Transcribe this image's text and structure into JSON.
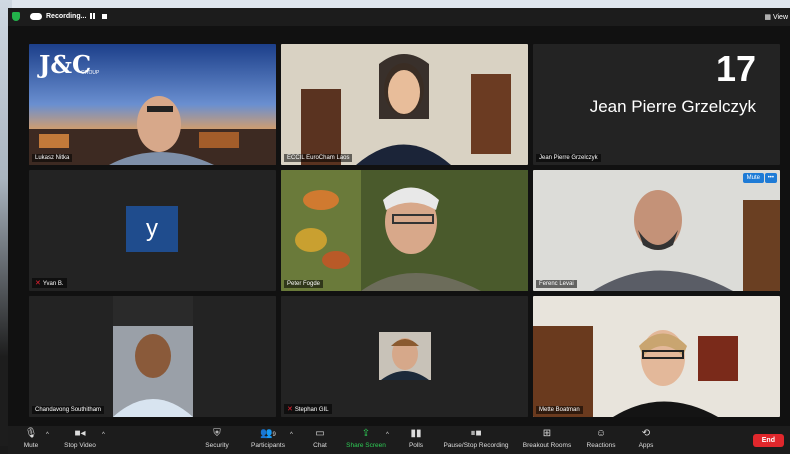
{
  "recording": {
    "label": "Recording..."
  },
  "view_label": "View",
  "tiles": [
    {
      "name": "Lukasz Nitka",
      "logo": "J&C",
      "logo_sub": "GROUP"
    },
    {
      "name": "ECCIL EuroCham Laos"
    },
    {
      "name": "Jean Pierre Grzelczyk",
      "big_name": "Jean Pierre Grzelczyk",
      "count": "17"
    },
    {
      "name": "Yvan B.",
      "avatar_letter": "y"
    },
    {
      "name": "Peter Fogde"
    },
    {
      "name": "Ferenc Levai",
      "mute_label": "Mute",
      "more_label": "•••"
    },
    {
      "name": "Chandavong Southitham"
    },
    {
      "name": "Stephan GIL"
    },
    {
      "name": "Mette Boatman"
    }
  ],
  "toolbar": {
    "mute": "Mute",
    "stop_video": "Stop Video",
    "security": "Security",
    "participants": "Participants",
    "participants_count": "9",
    "chat": "Chat",
    "share_screen": "Share Screen",
    "polls": "Polls",
    "recording": "Pause/Stop Recording",
    "breakout": "Breakout Rooms",
    "reactions": "Reactions",
    "apps": "Apps",
    "end": "End"
  }
}
